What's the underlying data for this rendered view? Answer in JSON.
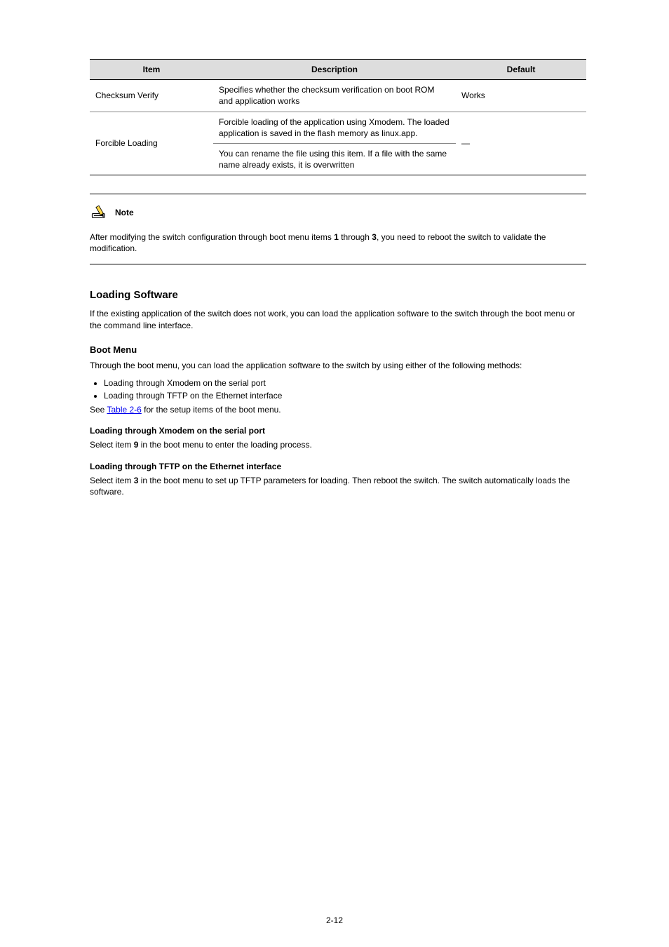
{
  "table": {
    "headers": [
      "Item",
      "Description",
      "Default"
    ],
    "rows": [
      {
        "item": "Checksum Verify",
        "desc": "Specifies whether the checksum verification on boot ROM and application works",
        "default": "Works"
      },
      {
        "item": "Forcible Loading",
        "desc_top": "Forcible loading of the application using Xmodem. The loaded application is saved in the flash memory as linux.app.",
        "desc_bottom": "You can rename the file using this item. If a file with the same name already exists, it is overwritten",
        "default": "—"
      }
    ]
  },
  "note": {
    "label": "Note",
    "body_pre": "After modifying the switch configuration through boot menu items ",
    "body_bold1": "1",
    "body_mid": " through ",
    "body_bold2": "3",
    "body_post": ", you need to reboot the switch to validate the modification."
  },
  "sections": {
    "h2": "Loading Software",
    "intro": "If the existing application of the switch does not work, you can load the application software to the switch through the boot menu or the command line interface.",
    "h3": "Boot Menu",
    "para1": "Through the boot menu, you can load the application software to the switch by using either of the following methods:",
    "bullets": [
      "Loading through Xmodem on the serial port",
      "Loading through TFTP on the Ethernet interface"
    ],
    "see_pre": "See ",
    "see_link": "Table 2-6",
    "see_post": " for the setup items of the boot menu.",
    "h4a": "Loading through Xmodem on the serial port",
    "para_a_pre": "Select item ",
    "para_a_bold": "9",
    "para_a_post": " in the boot menu to enter the loading process.",
    "h4b": "Loading through TFTP on the Ethernet interface",
    "para_b_pre": "Select item ",
    "para_b_bold": "3",
    "para_b_post": " in the boot menu to set up TFTP parameters for loading. Then reboot the switch. The switch automatically loads the software."
  },
  "footer": {
    "page": "2-12"
  }
}
